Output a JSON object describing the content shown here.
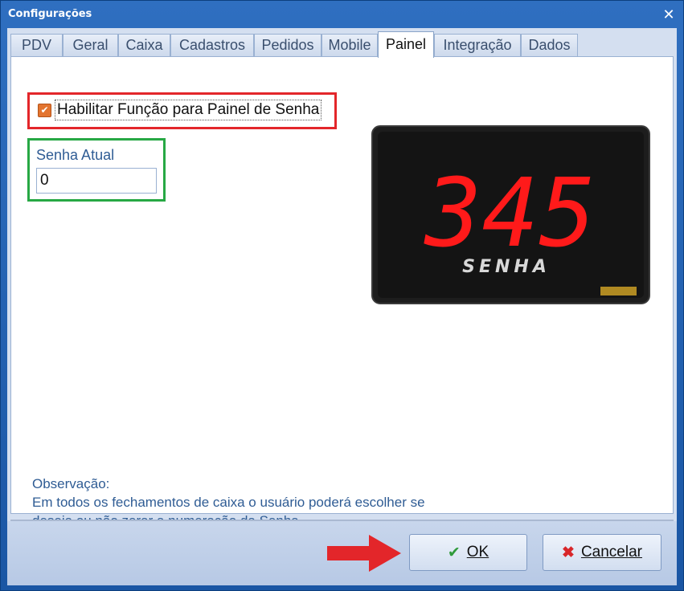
{
  "window": {
    "title": "Configurações",
    "close_glyph": "✕"
  },
  "tabs": [
    {
      "label": "PDV"
    },
    {
      "label": "Geral"
    },
    {
      "label": "Caixa"
    },
    {
      "label": "Cadastros"
    },
    {
      "label": "Pedidos"
    },
    {
      "label": "Mobile"
    },
    {
      "label": "Painel",
      "active": true
    },
    {
      "label": "Integração"
    },
    {
      "label": "Dados"
    }
  ],
  "painel": {
    "enable_checkbox": {
      "label": "Habilitar Função para Painel de Senha",
      "checked": true
    },
    "senha_atual": {
      "label": "Senha Atual",
      "value": "0"
    },
    "display_image": {
      "digits": "345",
      "caption": "SENHA",
      "led_color": "#ff1a1a"
    },
    "observacao": {
      "title": "Observação:",
      "line1": "Em todos os fechamentos de caixa o usuário poderá escolher se",
      "line2": "deseja ou não zerar a numeração da Senha."
    }
  },
  "footer": {
    "ok": {
      "label": "OK",
      "icon": "check-icon"
    },
    "cancel": {
      "label": "Cancelar",
      "icon": "x-icon"
    }
  },
  "colors": {
    "highlight_red": "#e3262a",
    "highlight_green": "#27a844",
    "arrow": "#e3262a",
    "label_blue": "#2f5c94"
  }
}
